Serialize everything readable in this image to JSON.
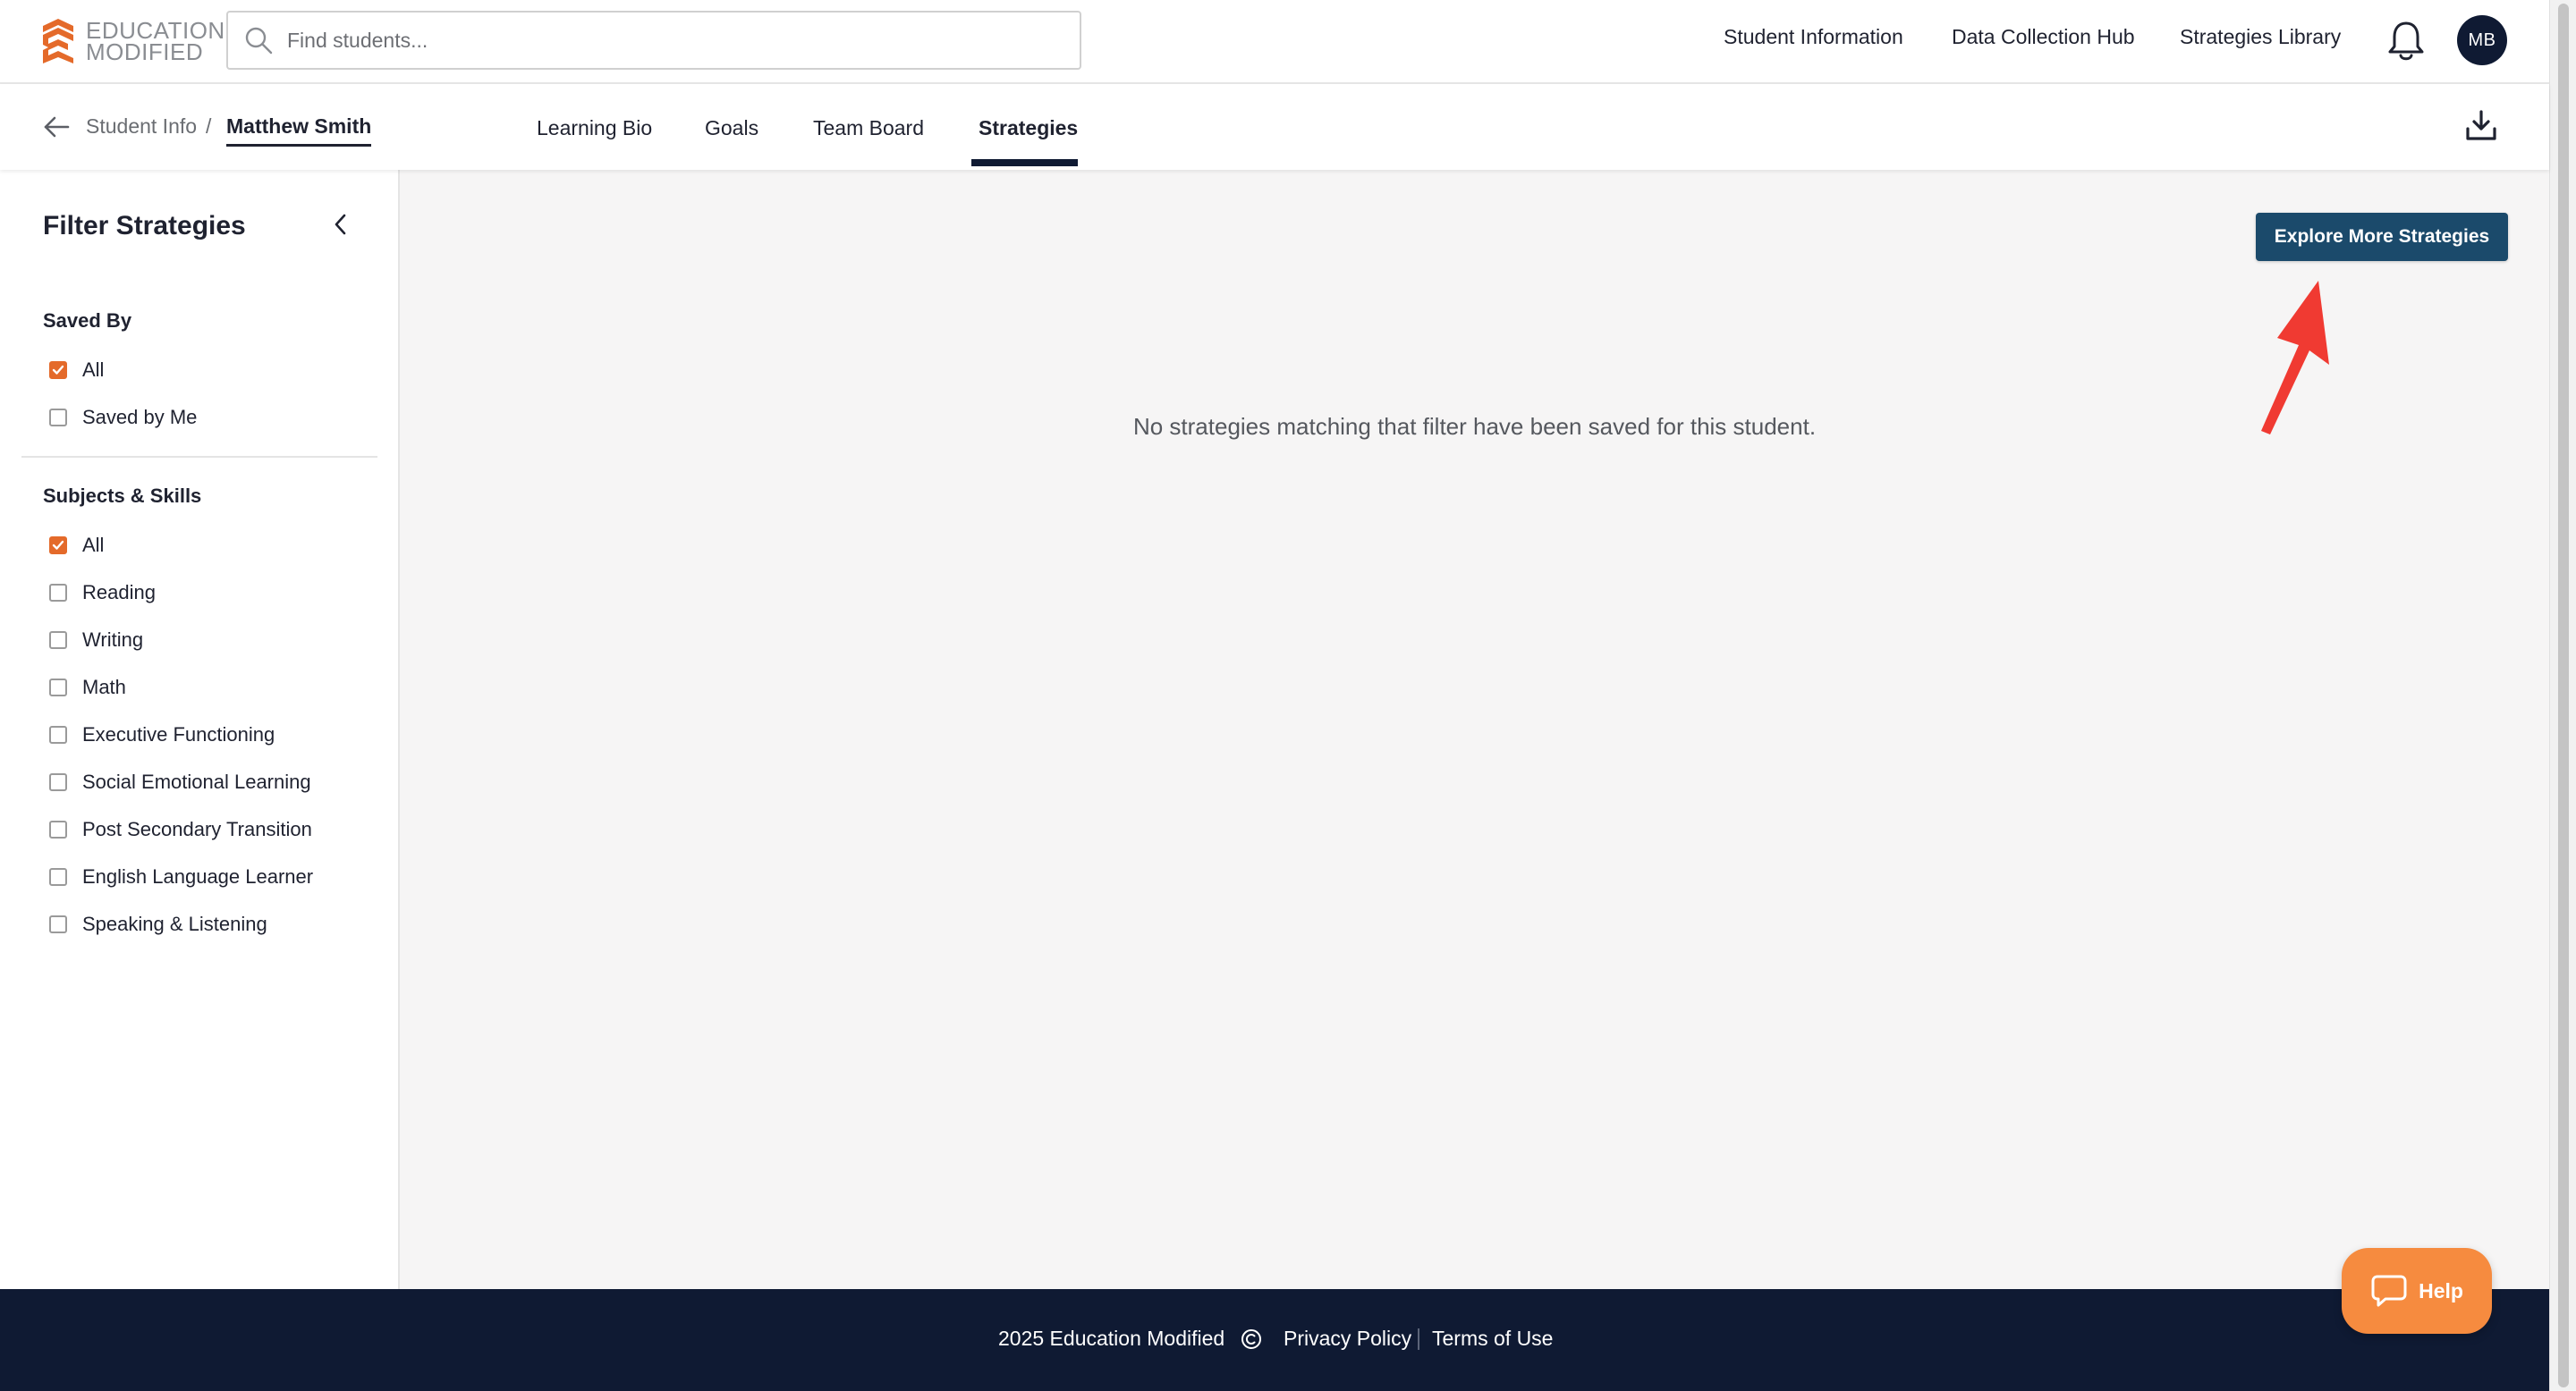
{
  "header": {
    "logo_line1": "EDUCATION",
    "logo_line2": "MODIFIED",
    "search_placeholder": "Find students...",
    "nav": [
      "Student Information",
      "Data Collection Hub",
      "Strategies Library"
    ],
    "avatar_initials": "MB"
  },
  "subheader": {
    "breadcrumb_parent": "Student Info",
    "breadcrumb_separator": "/",
    "student_name": "Matthew Smith",
    "tabs": [
      "Learning Bio",
      "Goals",
      "Team Board",
      "Strategies"
    ],
    "active_tab": "Strategies"
  },
  "sidebar": {
    "title": "Filter Strategies",
    "saved_by": {
      "title": "Saved By",
      "options": [
        {
          "label": "All",
          "checked": true
        },
        {
          "label": "Saved by Me",
          "checked": false
        }
      ]
    },
    "subjects": {
      "title": "Subjects & Skills",
      "options": [
        {
          "label": "All",
          "checked": true
        },
        {
          "label": "Reading",
          "checked": false
        },
        {
          "label": "Writing",
          "checked": false
        },
        {
          "label": "Math",
          "checked": false
        },
        {
          "label": "Executive Functioning",
          "checked": false
        },
        {
          "label": "Social Emotional Learning",
          "checked": false
        },
        {
          "label": "Post Secondary Transition",
          "checked": false
        },
        {
          "label": "English Language Learner",
          "checked": false
        },
        {
          "label": "Speaking & Listening",
          "checked": false
        }
      ]
    }
  },
  "main": {
    "explore_button": "Explore More Strategies",
    "empty_message": "No strategies matching that filter have been saved for this student."
  },
  "footer": {
    "copyright": "2025 Education Modified",
    "privacy": "Privacy Policy",
    "terms": "Terms of Use"
  },
  "help_label": "Help",
  "colors": {
    "brand_navy": "#0f1a33",
    "button_blue": "#1b4a6b",
    "checkbox_orange": "#e46a2a",
    "help_orange": "#f68b3f",
    "annotation_red": "#f03a32"
  }
}
